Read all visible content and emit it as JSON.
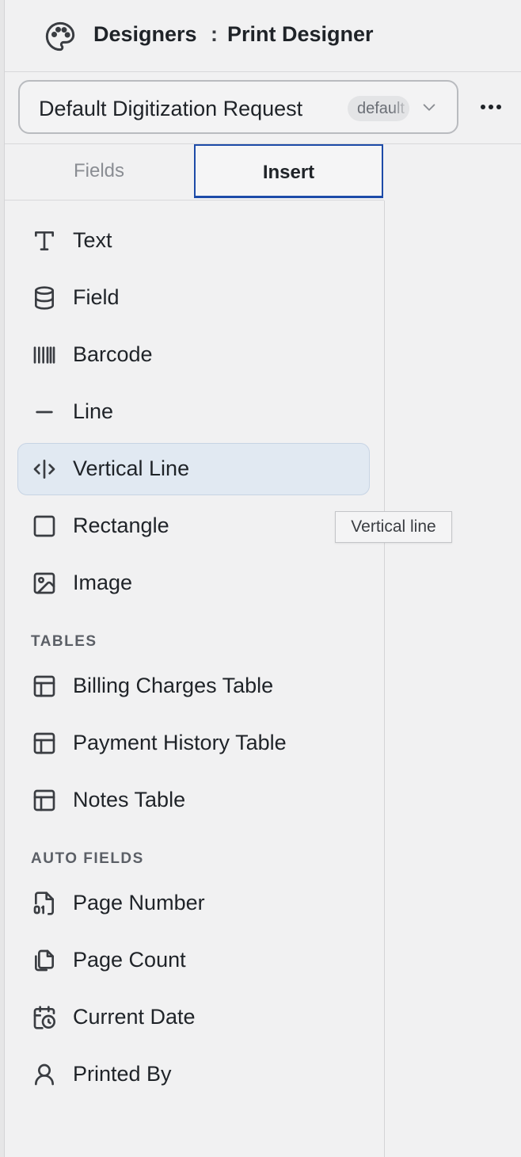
{
  "header": {
    "breadcrumb_1": "Designers",
    "separator": ":",
    "breadcrumb_2": "Print Designer"
  },
  "toolbar": {
    "document_title": "Default Digitization Request",
    "badge": "default"
  },
  "tabs": [
    {
      "label": "Fields"
    },
    {
      "label": "Insert"
    }
  ],
  "insert_items": [
    {
      "label": "Text",
      "icon": "text-icon"
    },
    {
      "label": "Field",
      "icon": "database-icon"
    },
    {
      "label": "Barcode",
      "icon": "barcode-icon"
    },
    {
      "label": "Line",
      "icon": "line-icon"
    },
    {
      "label": "Vertical Line",
      "icon": "vertical-line-icon"
    },
    {
      "label": "Rectangle",
      "icon": "square-icon"
    },
    {
      "label": "Image",
      "icon": "image-icon"
    }
  ],
  "sections": {
    "tables": "TABLES",
    "auto_fields": "AUTO FIELDS"
  },
  "table_items": [
    {
      "label": "Billing Charges Table",
      "icon": "table-icon"
    },
    {
      "label": "Payment History Table",
      "icon": "table-icon"
    },
    {
      "label": "Notes Table",
      "icon": "table-icon"
    }
  ],
  "auto_items": [
    {
      "label": "Page Number",
      "icon": "file-digit-icon"
    },
    {
      "label": "Page Count",
      "icon": "files-icon"
    },
    {
      "label": "Current Date",
      "icon": "calendar-clock-icon"
    },
    {
      "label": "Printed By",
      "icon": "user-icon"
    }
  ],
  "tooltip": "Vertical line",
  "colors": {
    "accent": "#1d4ba8",
    "active_bg": "#e1e9f2"
  }
}
